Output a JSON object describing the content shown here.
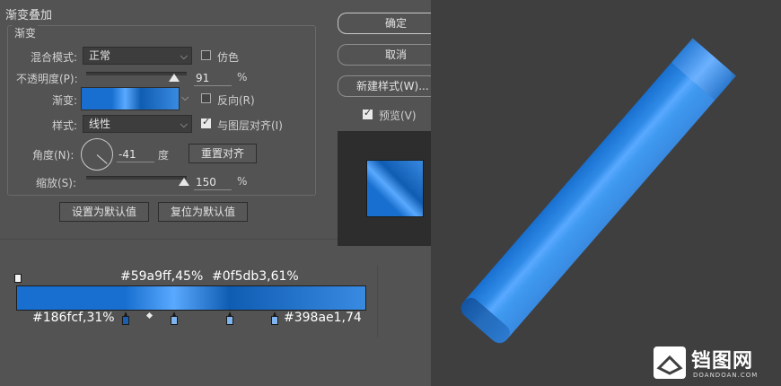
{
  "dialog": {
    "section_title": "渐变叠加",
    "group_title": "渐变",
    "blend_mode": {
      "label": "混合模式:",
      "value": "正常"
    },
    "dither": {
      "label": "仿色",
      "checked": false
    },
    "opacity": {
      "label": "不透明度(P):",
      "value": "91",
      "unit": "%",
      "fraction": 0.91
    },
    "gradient": {
      "label": "渐变:"
    },
    "reverse": {
      "label": "反向(R)",
      "checked": false
    },
    "style": {
      "label": "样式:",
      "value": "线性"
    },
    "align_with_layer": {
      "label": "与图层对齐(I)",
      "checked": true
    },
    "angle": {
      "label": "角度(N):",
      "value": "-41",
      "unit": "度",
      "degrees": -41
    },
    "reset_alignment": "重置对齐",
    "scale": {
      "label": "缩放(S):",
      "value": "150",
      "unit": "%",
      "fraction": 0.75
    },
    "make_default": "设置为默认值",
    "reset_default": "复位为默认值"
  },
  "side_buttons": {
    "ok": "确定",
    "cancel": "取消",
    "new_style": "新建样式(W)...",
    "preview": {
      "label": "预览(V)",
      "checked": true
    }
  },
  "gradient_stops": {
    "top_labels": [
      "#59a9ff,45%",
      "#0f5db3,61%"
    ],
    "bottom_labels": [
      "#186fcf,31%",
      "#398ae1,74"
    ],
    "stops": [
      {
        "color": "#186fcf",
        "location": 31
      },
      {
        "color": "#59a9ff",
        "location": 45
      },
      {
        "color": "#0f5db3",
        "location": 61
      },
      {
        "color": "#398ae1",
        "location": 74
      }
    ]
  },
  "watermark": {
    "brand": "铛图网",
    "sub": "DOANDOAN.COM"
  },
  "colors": {
    "stop1": "#186fcf",
    "stop2": "#59a9ff",
    "stop3": "#0f5db3",
    "stop4": "#398ae1",
    "dialog_bg": "#535353",
    "canvas_bg": "#3f3f3f"
  }
}
